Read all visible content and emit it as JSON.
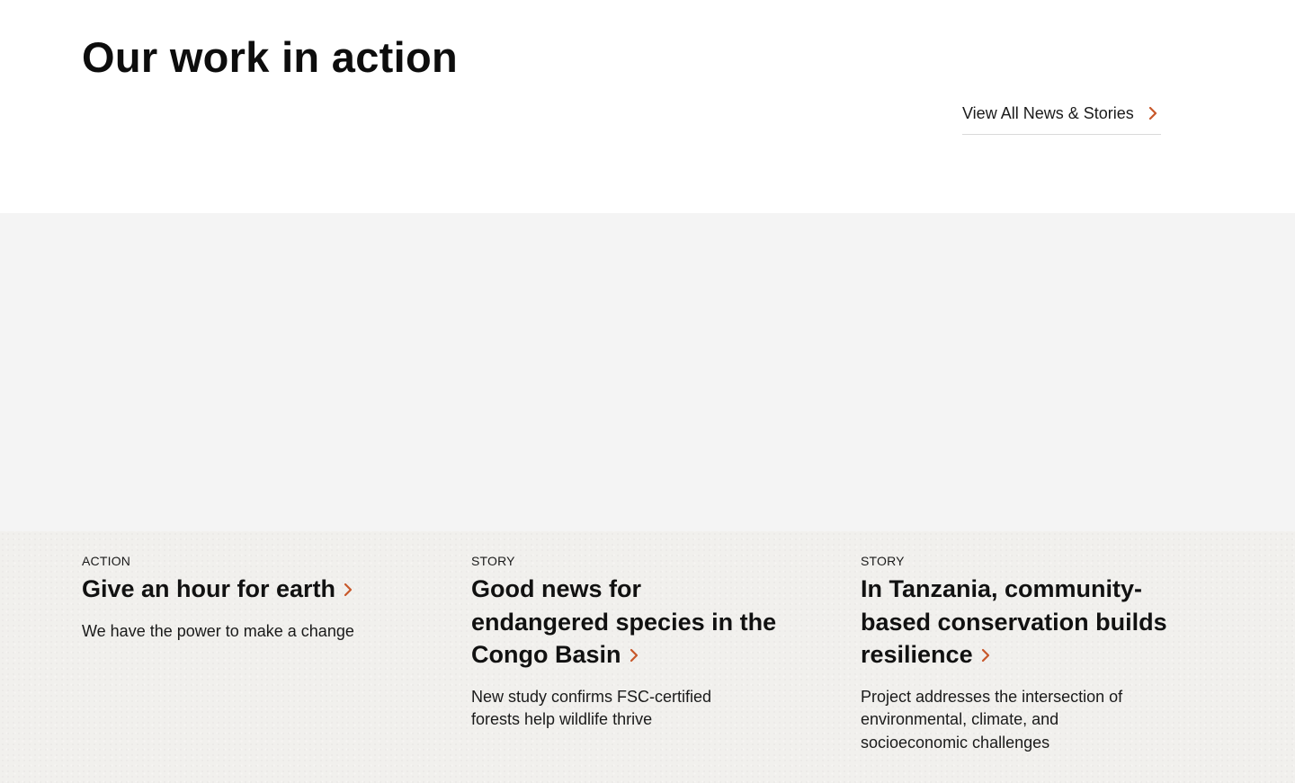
{
  "header": {
    "title": "Our work in action",
    "view_all_label": "View All News & Stories"
  },
  "cards": [
    {
      "kicker": "ACTION",
      "title": "Give an hour for earth",
      "description": "We have the power to make a change"
    },
    {
      "kicker": "STORY",
      "title": "Good news for endangered species in the Congo Basin",
      "description": "New study confirms FSC-certified forests help wildlife thrive"
    },
    {
      "kicker": "STORY",
      "title": "In Tanzania, community-based conservation builds resilience",
      "description": "Project addresses the intersection of environmental, climate, and socioeconomic challenges"
    }
  ],
  "colors": {
    "accent": "#c8582a",
    "image_placeholder": "#f4f4f4",
    "card_band": "#f1f0ed",
    "text": "#111111"
  },
  "icons": {
    "link_arrow": "chevron-right-icon"
  }
}
